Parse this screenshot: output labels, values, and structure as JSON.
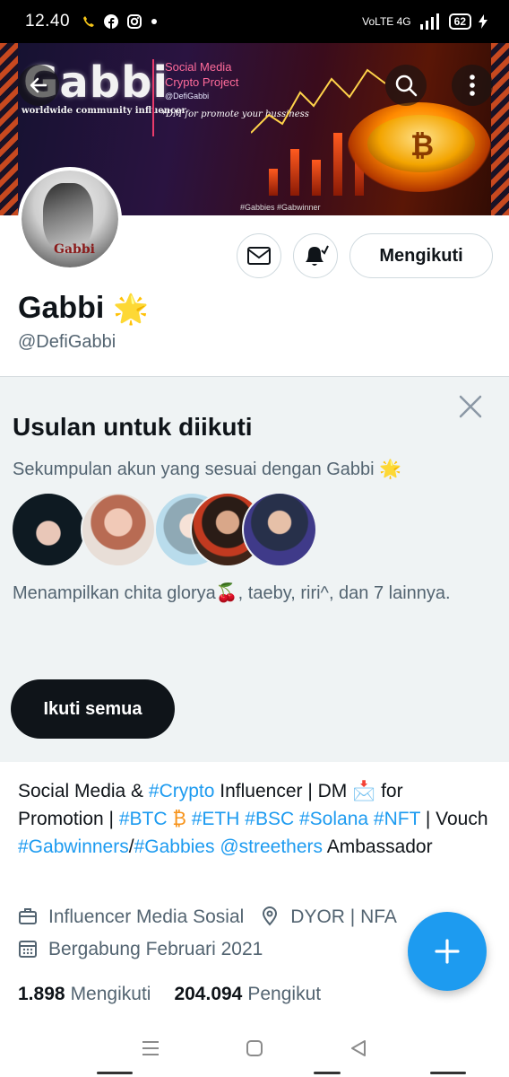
{
  "status_bar": {
    "time": "12.40",
    "network": "VoLTE 4G",
    "battery": "62"
  },
  "banner": {
    "logo_text": "Gabbi",
    "tagline": "worldwide community influencer",
    "line1": "Social Media",
    "line2": "Crypto Project",
    "handle": "@DefiGabbi",
    "dm_note": "*DM for promote your bussiness",
    "hashtags": "#Gabbies #Gabwinner"
  },
  "profile": {
    "avatar_label": "Gabbi",
    "name": "Gabbi",
    "name_emoji": "🌟",
    "handle": "@DefiGabbi",
    "follow_state_label": "Mengikuti"
  },
  "suggestions": {
    "title": "Usulan untuk diikuti",
    "subtitle": "Sekumpulan akun yang sesuai dengan Gabbi 🌟",
    "names_text": "Menampilkan chita glorya🍒, taeby, riri^, dan 7 lainnya.",
    "follow_all_label": "Ikuti semua"
  },
  "bio": {
    "t1": "Social Media & ",
    "h1": "#Crypto",
    "t2": " Influencer | DM 📩 for Promotion | ",
    "h2": "#BTC",
    "t3": " ₿ ",
    "h3": "#ETH",
    "t4": " ",
    "h4": "#BSC",
    "t5": " ",
    "h5": "#Solana",
    "t6": " ",
    "h6": "#NFT",
    "t7": " | Vouch ",
    "h7": "#Gabwinners",
    "t8": "/",
    "h8": "#Gabbies",
    "t9": " ",
    "h9": "@streethers",
    "t10": " Ambassador"
  },
  "meta": {
    "category": "Influencer Media Sosial",
    "location": "DYOR | NFA",
    "joined": "Bergabung Februari 2021"
  },
  "stats": {
    "following_count": "1.898",
    "following_label": "Mengikuti",
    "followers_count": "204.094",
    "followers_label": "Pengikut"
  },
  "colors": {
    "accent": "#1d9bf0",
    "text": "#0f1419",
    "muted": "#536471",
    "card_bg": "#eff3f4"
  },
  "icons": [
    "back-arrow-icon",
    "search-icon",
    "more-vertical-icon",
    "mail-icon",
    "bell-icon",
    "close-icon",
    "briefcase-icon",
    "location-pin-icon",
    "calendar-icon",
    "plus-icon",
    "nav-menu-icon",
    "nav-home-icon",
    "nav-back-icon"
  ]
}
